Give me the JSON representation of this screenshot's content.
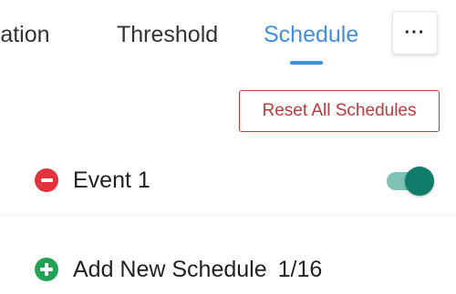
{
  "tabs": {
    "items": [
      {
        "label": "ration"
      },
      {
        "label": "Threshold"
      },
      {
        "label": "Schedule"
      }
    ],
    "active_index": 2,
    "more_label": "···"
  },
  "actions": {
    "reset_label": "Reset All Schedules"
  },
  "events": [
    {
      "label": "Event 1",
      "enabled": true
    }
  ],
  "add_schedule": {
    "label": "Add New Schedule",
    "count": "1/16"
  },
  "colors": {
    "accent": "#3d8fe0",
    "danger": "#c0393b",
    "remove": "#e2333a",
    "add": "#23a154",
    "toggle_on": "#0f7d69"
  },
  "icons": {
    "remove": "remove-circle-icon",
    "add": "add-circle-icon",
    "more": "more-horizontal-icon"
  }
}
